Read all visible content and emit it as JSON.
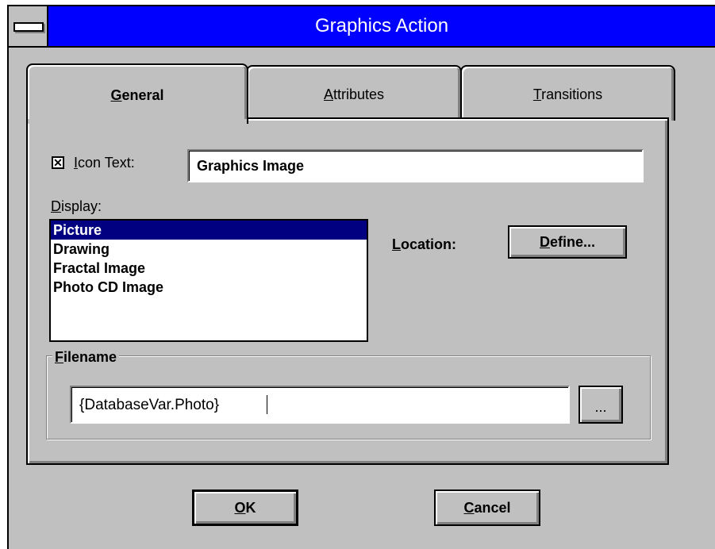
{
  "window": {
    "title": "Graphics Action"
  },
  "tabs": [
    {
      "label": "General",
      "mnemonic": "G",
      "rest": "eneral",
      "active": true
    },
    {
      "label": "Attributes",
      "mnemonic": "A",
      "rest": "ttributes",
      "active": false
    },
    {
      "label": "Transitions",
      "mnemonic": "T",
      "rest": "ransitions",
      "active": false
    }
  ],
  "general": {
    "icon_text": {
      "checked": true,
      "check_glyph": "✕",
      "mnemonic": "I",
      "rest": "con Text:",
      "value": "Graphics Image"
    },
    "display": {
      "mnemonic": "D",
      "rest": "isplay:",
      "items": [
        "Picture",
        "Drawing",
        "Fractal Image",
        "Photo CD Image"
      ],
      "selected": "Picture"
    },
    "location": {
      "mnemonic": "L",
      "rest": "ocation:"
    },
    "define_button": {
      "mnemonic": "D",
      "rest": "efine..."
    },
    "filename": {
      "mnemonic": "F",
      "rest": "ilename",
      "value": "{DatabaseVar.Photo}",
      "browse_label": "..."
    }
  },
  "buttons": {
    "ok": {
      "mnemonic": "O",
      "rest": "K"
    },
    "cancel": {
      "mnemonic": "C",
      "rest": "ancel"
    }
  },
  "colors": {
    "title_bar": "#0000ff",
    "face": "#c0c0c0",
    "selection": "#000080"
  }
}
